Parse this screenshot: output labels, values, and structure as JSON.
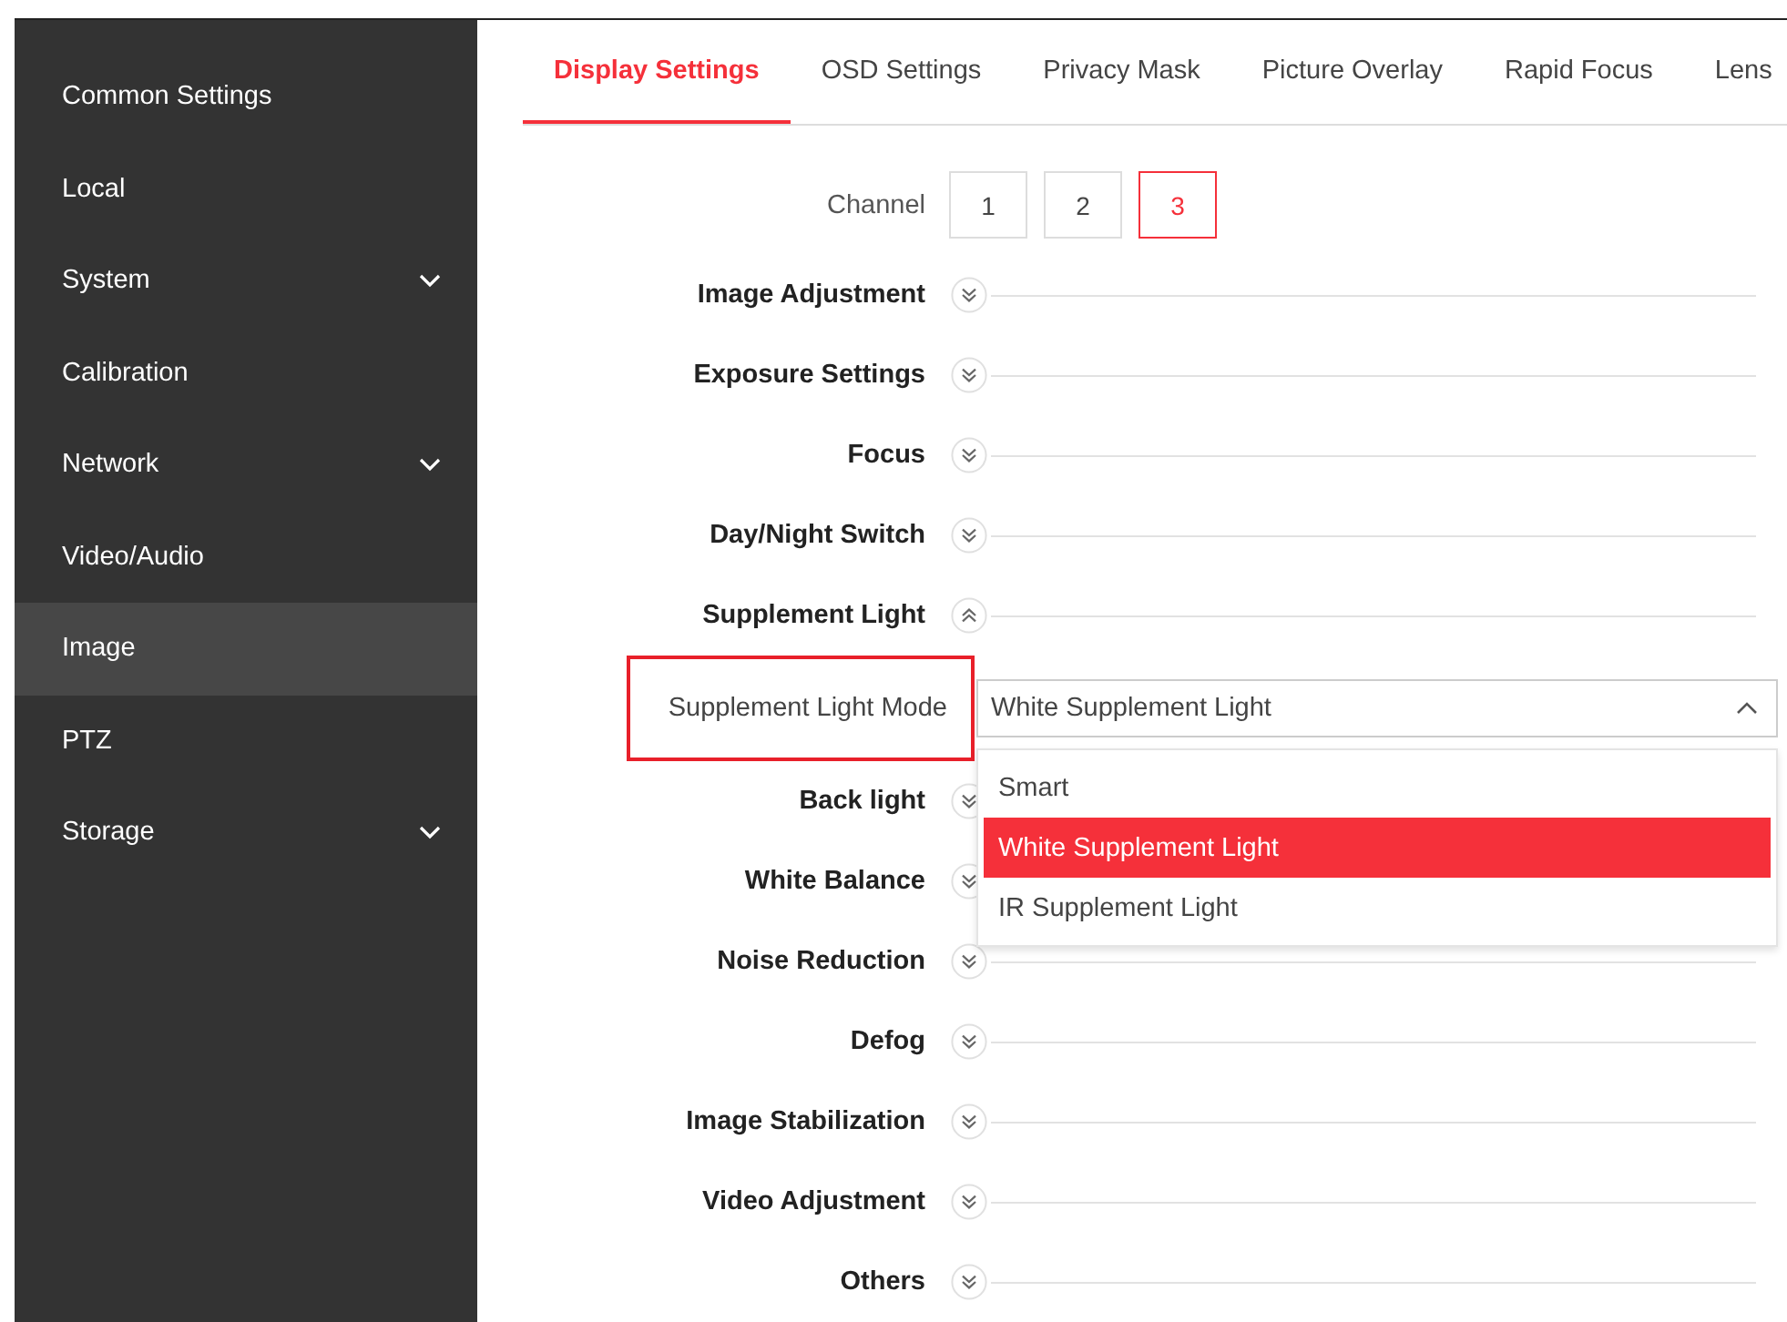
{
  "sidebar": {
    "items": [
      {
        "label": "Common Settings",
        "selected": false,
        "expandable": false
      },
      {
        "label": "Local",
        "selected": false,
        "expandable": false
      },
      {
        "label": "System",
        "selected": false,
        "expandable": true
      },
      {
        "label": "Calibration",
        "selected": false,
        "expandable": false
      },
      {
        "label": "Network",
        "selected": false,
        "expandable": true
      },
      {
        "label": "Video/Audio",
        "selected": false,
        "expandable": false
      },
      {
        "label": "Image",
        "selected": true,
        "expandable": false
      },
      {
        "label": "PTZ",
        "selected": false,
        "expandable": false
      },
      {
        "label": "Storage",
        "selected": false,
        "expandable": true
      }
    ]
  },
  "tabs": [
    {
      "label": "Display Settings",
      "selected": true
    },
    {
      "label": "OSD Settings",
      "selected": false
    },
    {
      "label": "Privacy Mask",
      "selected": false
    },
    {
      "label": "Picture Overlay",
      "selected": false
    },
    {
      "label": "Rapid Focus",
      "selected": false
    },
    {
      "label": "Lens",
      "selected": false
    }
  ],
  "channel": {
    "label": "Channel",
    "options": [
      {
        "label": "1",
        "selected": false
      },
      {
        "label": "2",
        "selected": false
      },
      {
        "label": "3",
        "selected": true
      }
    ]
  },
  "sections": [
    {
      "title": "Image Adjustment",
      "expanded": false
    },
    {
      "title": "Exposure Settings",
      "expanded": false
    },
    {
      "title": "Focus",
      "expanded": false
    },
    {
      "title": "Day/Night Switch",
      "expanded": false
    },
    {
      "title": "Supplement Light",
      "expanded": true,
      "fields": [
        {
          "label": "Supplement Light Mode",
          "highlighted": true,
          "value": "White Supplement Light",
          "open": true,
          "options": [
            {
              "label": "Smart",
              "selected": false
            },
            {
              "label": "White Supplement Light",
              "selected": true
            },
            {
              "label": "IR Supplement Light",
              "selected": false
            }
          ]
        }
      ]
    },
    {
      "title": "Back light",
      "expanded": false
    },
    {
      "title": "White Balance",
      "expanded": false
    },
    {
      "title": "Noise Reduction",
      "expanded": false
    },
    {
      "title": "Defog",
      "expanded": false
    },
    {
      "title": "Image Stabilization",
      "expanded": false
    },
    {
      "title": "Video Adjustment",
      "expanded": false
    },
    {
      "title": "Others",
      "expanded": false
    }
  ]
}
